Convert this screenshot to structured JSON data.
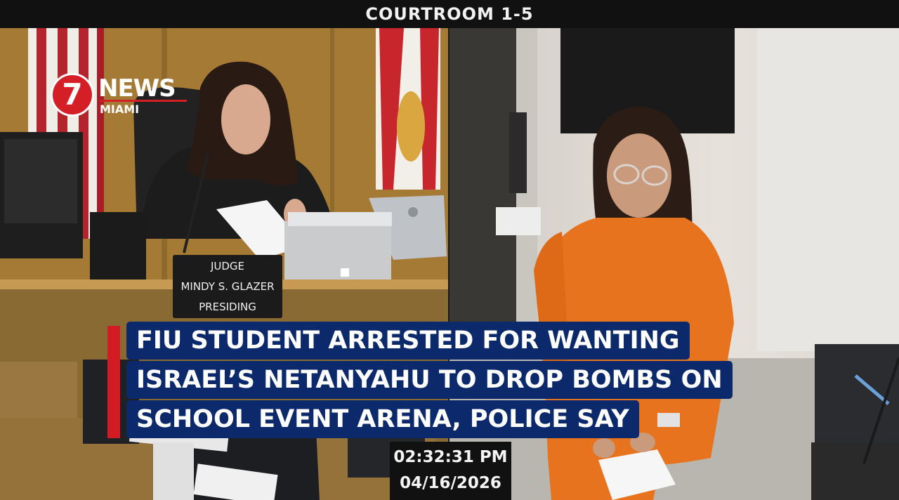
{
  "header": {
    "title": "COURTROOM 1-5"
  },
  "logo": {
    "number": "7",
    "brand": "NEWS",
    "city": "MIAMI"
  },
  "nameplate": {
    "line1": "JUDGE",
    "line2": "MINDY S. GLAZER",
    "line3": "PRESIDING"
  },
  "headline": {
    "lines": [
      "FIU STUDENT ARRESTED FOR WANTING",
      "ISRAEL’S NETANYAHU TO DROP BOMBS ON",
      "SCHOOL EVENT ARENA, POLICE SAY"
    ]
  },
  "timestamp": {
    "time": "02:32:31 PM",
    "date": "04/16/2026"
  },
  "colors": {
    "headline_bg": "#0c2a6b",
    "accent_red": "#d21b22",
    "jumpsuit": "#e8731f",
    "wood": "#a77c36"
  }
}
